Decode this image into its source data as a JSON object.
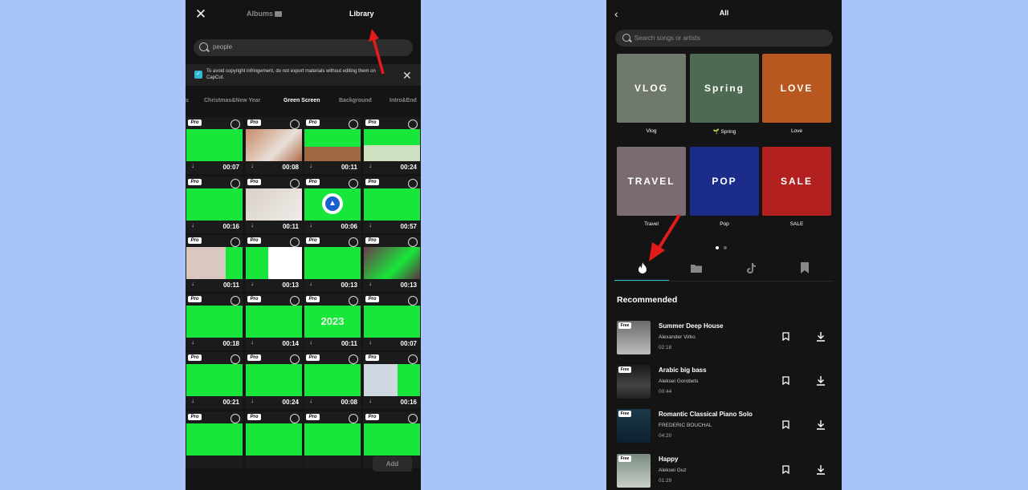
{
  "left": {
    "tabs": {
      "albums": "Albums",
      "library": "Library"
    },
    "search_value": "people",
    "notice": "To avoid copyright infringement, do not export materials without editing them on CapCut.",
    "categories": [
      "s",
      "Christmas&New Year",
      "Green Screen",
      "Background",
      "Intro&End"
    ],
    "active_category": "Green Screen",
    "pro_label": "Pro",
    "durations": [
      "00:07",
      "00:08",
      "00:11",
      "00:24",
      "00:16",
      "00:11",
      "00:06",
      "00:57",
      "00:11",
      "00:13",
      "00:13",
      "00:13",
      "00:18",
      "00:14",
      "00:11",
      "00:07",
      "00:21",
      "00:24",
      "00:08",
      "00:16"
    ],
    "tile_text_2023": "2023",
    "add_label": "Add"
  },
  "right": {
    "title": "All",
    "search_placeholder": "Search songs or artists",
    "playlists": [
      {
        "name": "Vlog",
        "overlay": "VLOG",
        "color": "#6f7a6c"
      },
      {
        "name": "🌱 Spring",
        "overlay": "Spring",
        "color": "#4f6a52"
      },
      {
        "name": "Love",
        "overlay": "LOVE",
        "color": "#b8571f"
      },
      {
        "name": "Travel",
        "overlay": "TRAVEL",
        "color": "#7a6a72"
      },
      {
        "name": "Pop",
        "overlay": "POP",
        "color": "#1c2c8a"
      },
      {
        "name": "SALE",
        "overlay": "SALE",
        "color": "#b32020"
      }
    ],
    "recommended_title": "Recommended",
    "free_label": "Free",
    "songs": [
      {
        "title": "Summer Deep House",
        "artist": "Alexander Virko",
        "duration": "02:18"
      },
      {
        "title": "Arabic big bass",
        "artist": "Aleksei Gorobets",
        "duration": "00:44"
      },
      {
        "title": "Romantic Classical Piano Solo",
        "artist": "FREDERIC BOUCHAL",
        "duration": "04:20"
      },
      {
        "title": "Happy",
        "artist": "Aleksei Guz",
        "duration": "01:29"
      }
    ]
  },
  "colors": {
    "accent": "#2fb7d4",
    "green_screen": "#17e63a",
    "arrow": "#e21b1b",
    "background": "#a9c4f8"
  }
}
